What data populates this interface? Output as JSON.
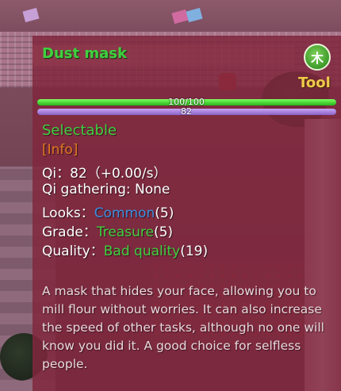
{
  "item": {
    "name": "Dust mask",
    "element_glyph": "木",
    "type_label": "Tool",
    "bar_primary": {
      "text": "100/100",
      "fraction": 1.0,
      "color": "#3fd13f"
    },
    "bar_secondary": {
      "text": "82",
      "fraction": 1.0,
      "color": "#a87fe0"
    },
    "selectable_label": "Selectable",
    "info_label": "[Info]",
    "stats": {
      "qi_label": "Qi：",
      "qi_value": "82（+0.00/s）",
      "qi_gathering_label": "Qi gathering: ",
      "qi_gathering_value": "None",
      "looks_label": "Looks：",
      "looks_value": "Common",
      "looks_score": "(5)",
      "grade_label": "Grade：",
      "grade_value": "Treasure",
      "grade_score": "(5)",
      "quality_label": "Quality：",
      "quality_value": "Bad quality",
      "quality_score": "(19)"
    },
    "description": "A mask that hides your face, allowing you to mill flour without worries. It can also increase the speed of other tasks, although no one will know you did it. A good choice for selfless people."
  },
  "colors": {
    "name": "#3fd13f",
    "type": "#f2c94c",
    "info": "#e07a1f",
    "common": "#3b8fe0",
    "treasure": "#3fd13f",
    "panel": "#80283e"
  }
}
